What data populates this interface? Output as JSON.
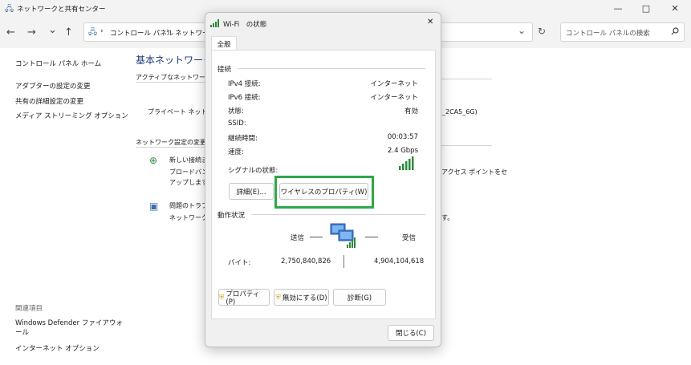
{
  "window": {
    "title": "ネットワークと共有センター",
    "minimize": "—",
    "maximize": "□",
    "close": "✕"
  },
  "nav": {
    "back": "←",
    "forward": "→",
    "recent": "⌄",
    "up": "↑",
    "refresh": "↻",
    "dropdown": "⌄"
  },
  "address": {
    "sep": "›",
    "crumbs": [
      "コントロール パネル",
      "ネットワーク"
    ]
  },
  "search": {
    "placeholder": "コントロール パネルの検索"
  },
  "sidebar": {
    "home": "コントロール パネル ホーム",
    "links": [
      "アダプターの設定の変更",
      "共有の詳細設定の変更",
      "メディア ストリーミング オプション"
    ],
    "related_title": "関連項目",
    "related": [
      "Windows Defender ファイアウォール",
      "インターネット オプション"
    ]
  },
  "main": {
    "heading": "基本ネットワーク情",
    "active": "アクティブなネットワークの",
    "private": "プライベート ネットワーク",
    "network_suffix": "_2CA5_6G)",
    "change_settings": "ネットワーク設定の変更",
    "new_conn": "新しい接続ま",
    "new_conn_desc1": "ブロードバンド",
    "new_conn_desc2": "アップします。",
    "new_conn_desc_right": "アクセス ポイントをセ",
    "trouble": "問題のトラブ",
    "trouble_desc": "ネットワークの",
    "trouble_desc_right": "す。"
  },
  "dialog": {
    "title": "Wi-Fi　の状態",
    "close": "✕",
    "tab": "全般",
    "connection_title": "接続",
    "rows": [
      {
        "label": "IPv4 接続:",
        "value": "インターネット"
      },
      {
        "label": "IPv6 接続:",
        "value": "インターネット"
      },
      {
        "label": "状態:",
        "value": "有効"
      },
      {
        "label": "SSID:",
        "value": ""
      },
      {
        "label": "継続時間:",
        "value": "00:03:57"
      },
      {
        "label": "速度:",
        "value": "2.4 Gbps"
      }
    ],
    "signal_label": "シグナルの状態:",
    "details_btn": "詳細(E)...",
    "wireless_btn": "ワイヤレスのプロパティ(W)",
    "activity_title": "動作状況",
    "sent": "送信",
    "received": "受信",
    "bytes_label": "バイト:",
    "bytes_sent": "2,750,840,826",
    "bytes_received": "4,904,104,618",
    "props_btn": "プロパティ(P)",
    "disable_btn": "無効にする(D)",
    "diagnose_btn": "診断(G)",
    "close_btn": "閉じる(C)",
    "highlight_color": "#2ea84a"
  }
}
